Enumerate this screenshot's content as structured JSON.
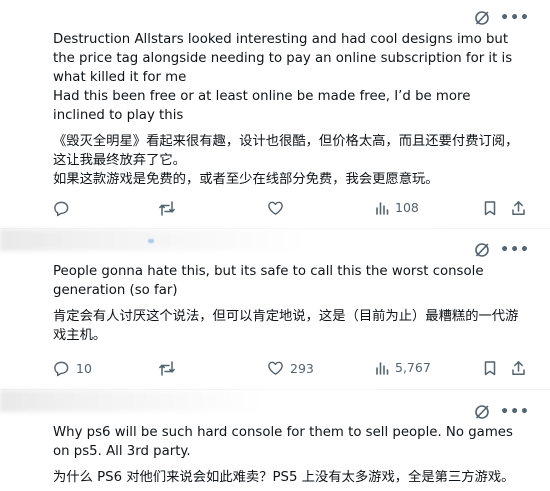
{
  "posts": [
    {
      "paragraphs": [
        "Destruction Allstars looked interesting and had cool designs imo but the price tag alongside needing to pay an online subscription for it is what killed it for me",
        "Had this been free or at least online be made free, I’d be more inclined to play this"
      ],
      "translation": [
        "《毁灭全明星》看起来很有趣，设计也很酷，但价格太高，而且还要付费订阅，这让我最终放弃了它。",
        "如果这款游戏是免费的，或者至少在线部分免费，我会更愿意玩。"
      ],
      "stats": {
        "replies": "",
        "reposts": "",
        "likes": "",
        "views": "108"
      }
    },
    {
      "paragraphs": [
        "People gonna hate this, but its safe to call this the worst console generation (so far)"
      ],
      "translation": [
        "肯定会有人讨厌这个说法，但可以肯定地说，这是（目前为止）最糟糕的一代游戏主机。"
      ],
      "stats": {
        "replies": "10",
        "reposts": "",
        "likes": "293",
        "views": "5,767"
      }
    },
    {
      "paragraphs": [
        "Why ps6 will be such hard console for them to sell people. No games on ps5. All 3rd party."
      ],
      "translation": [
        "为什么 PS6 对他们来说会如此难卖？PS5 上没有太多游戏，全是第三方游戏。"
      ],
      "stats": {}
    }
  ],
  "icons": {
    "grok": "grok-icon",
    "more": "more-icon",
    "reply": "reply-icon",
    "repost": "repost-icon",
    "like": "like-icon",
    "views": "views-icon",
    "bookmark": "bookmark-icon",
    "share": "share-icon"
  },
  "more_glyph": "•••",
  "colors": {
    "muted": "#536471",
    "text": "#0f1419",
    "divider": "#eff3f4"
  }
}
